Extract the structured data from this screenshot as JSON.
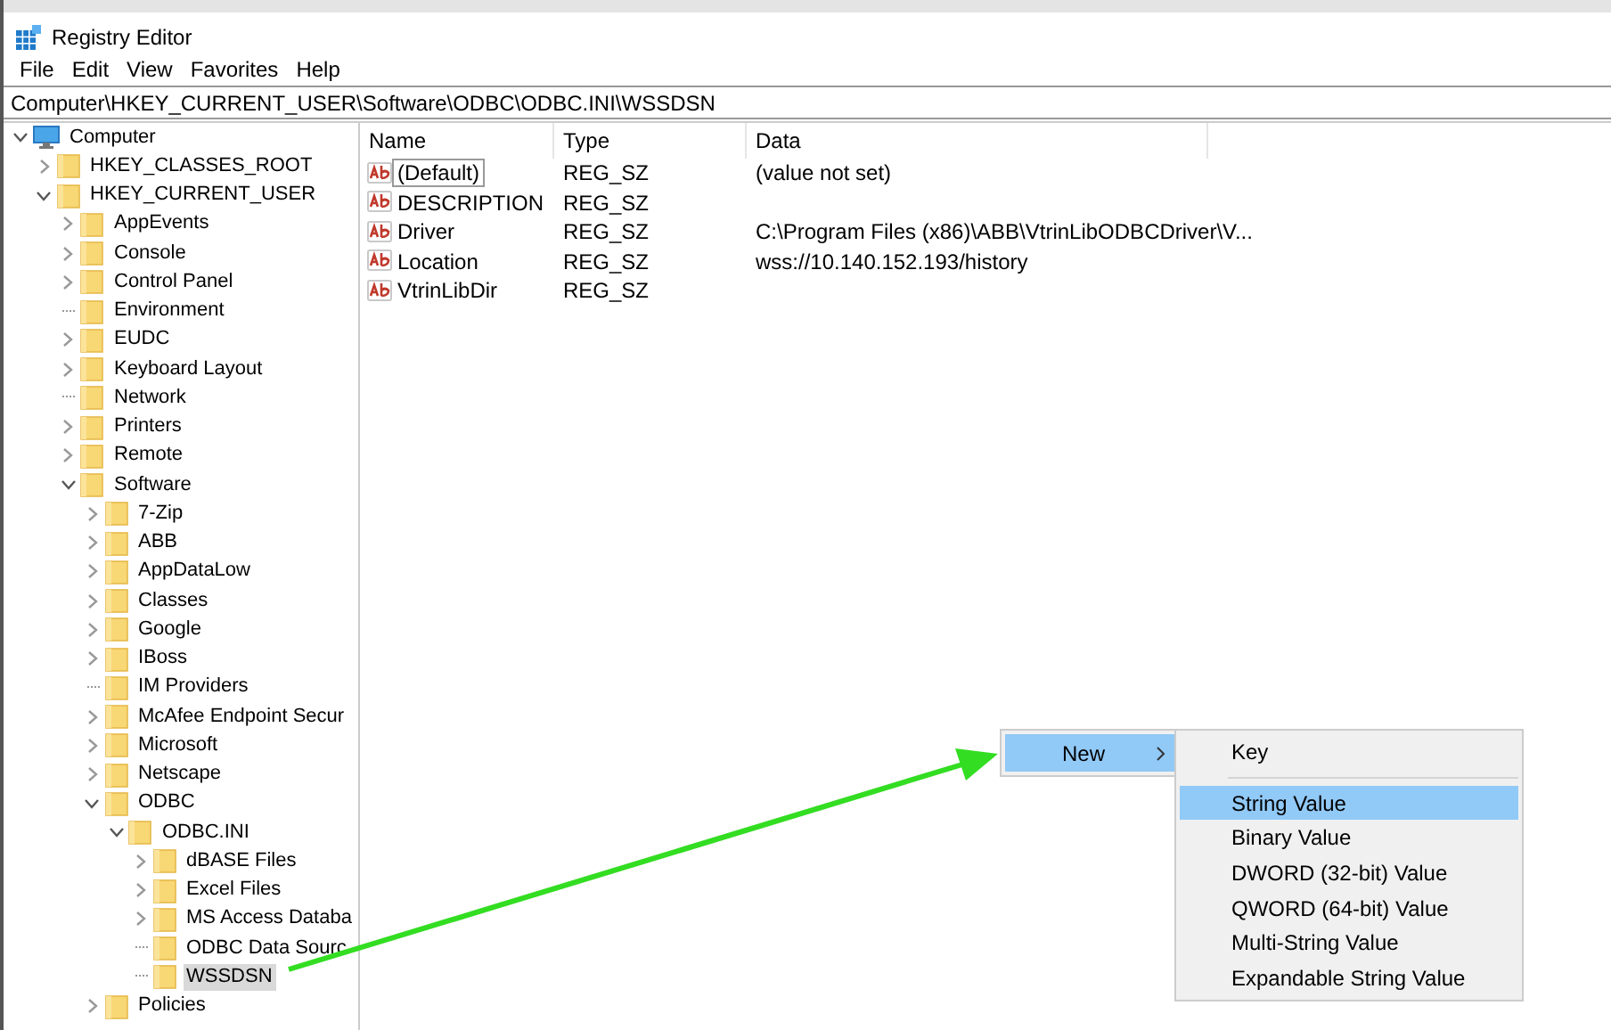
{
  "window": {
    "title": "Registry Editor"
  },
  "menu_bar": [
    "File",
    "Edit",
    "View",
    "Favorites",
    "Help"
  ],
  "address_bar": {
    "value": "Computer\\HKEY_CURRENT_USER\\Software\\ODBC\\ODBC.INI\\WSSDSN"
  },
  "tree": [
    {
      "label": "Computer",
      "kind": "computer",
      "expanded": true,
      "selected": false,
      "children": [
        {
          "label": "HKEY_CLASSES_ROOT",
          "kind": "folder",
          "expanded": false,
          "selected": false
        },
        {
          "label": "HKEY_CURRENT_USER",
          "kind": "folder",
          "expanded": true,
          "selected": false,
          "children": [
            {
              "label": "AppEvents",
              "kind": "folder",
              "expanded": false,
              "selected": false
            },
            {
              "label": "Console",
              "kind": "folder",
              "expanded": false,
              "selected": false
            },
            {
              "label": "Control Panel",
              "kind": "folder",
              "expanded": false,
              "selected": false
            },
            {
              "label": "Environment",
              "kind": "leaf-folder",
              "expanded": false,
              "selected": false
            },
            {
              "label": "EUDC",
              "kind": "folder",
              "expanded": false,
              "selected": false
            },
            {
              "label": "Keyboard Layout",
              "kind": "folder",
              "expanded": false,
              "selected": false
            },
            {
              "label": "Network",
              "kind": "leaf-folder",
              "expanded": false,
              "selected": false
            },
            {
              "label": "Printers",
              "kind": "folder",
              "expanded": false,
              "selected": false
            },
            {
              "label": "Remote",
              "kind": "folder",
              "expanded": false,
              "selected": false
            },
            {
              "label": "Software",
              "kind": "folder",
              "expanded": true,
              "selected": false,
              "children": [
                {
                  "label": "7-Zip",
                  "kind": "folder",
                  "expanded": false,
                  "selected": false
                },
                {
                  "label": "ABB",
                  "kind": "folder",
                  "expanded": false,
                  "selected": false
                },
                {
                  "label": "AppDataLow",
                  "kind": "folder",
                  "expanded": false,
                  "selected": false
                },
                {
                  "label": "Classes",
                  "kind": "folder",
                  "expanded": false,
                  "selected": false
                },
                {
                  "label": "Google",
                  "kind": "folder",
                  "expanded": false,
                  "selected": false
                },
                {
                  "label": "IBoss",
                  "kind": "folder",
                  "expanded": false,
                  "selected": false
                },
                {
                  "label": "IM Providers",
                  "kind": "leaf-folder",
                  "expanded": false,
                  "selected": false
                },
                {
                  "label": "McAfee Endpoint Secur",
                  "kind": "folder",
                  "expanded": false,
                  "selected": false
                },
                {
                  "label": "Microsoft",
                  "kind": "folder",
                  "expanded": false,
                  "selected": false
                },
                {
                  "label": "Netscape",
                  "kind": "folder",
                  "expanded": false,
                  "selected": false
                },
                {
                  "label": "ODBC",
                  "kind": "folder",
                  "expanded": true,
                  "selected": false,
                  "children": [
                    {
                      "label": "ODBC.INI",
                      "kind": "folder",
                      "expanded": true,
                      "selected": false,
                      "children": [
                        {
                          "label": "dBASE Files",
                          "kind": "folder",
                          "expanded": false,
                          "selected": false
                        },
                        {
                          "label": "Excel Files",
                          "kind": "folder",
                          "expanded": false,
                          "selected": false
                        },
                        {
                          "label": "MS Access Databa",
                          "kind": "folder",
                          "expanded": false,
                          "selected": false
                        },
                        {
                          "label": "ODBC Data Sourc",
                          "kind": "leaf-folder",
                          "expanded": false,
                          "selected": false
                        },
                        {
                          "label": "WSSDSN",
                          "kind": "leaf-folder",
                          "expanded": false,
                          "selected": true
                        }
                      ]
                    }
                  ]
                },
                {
                  "label": "Policies",
                  "kind": "folder",
                  "expanded": false,
                  "selected": false
                }
              ]
            }
          ]
        }
      ]
    }
  ],
  "values_table": {
    "columns": [
      "Name",
      "Type",
      "Data"
    ],
    "rows": [
      {
        "name": "(Default)",
        "type": "REG_SZ",
        "data": "(value not set)",
        "focused": true
      },
      {
        "name": "DESCRIPTION",
        "type": "REG_SZ",
        "data": "",
        "focused": false
      },
      {
        "name": "Driver",
        "type": "REG_SZ",
        "data": "C:\\Program Files (x86)\\ABB\\VtrinLibODBCDriver\\V...",
        "focused": false
      },
      {
        "name": "Location",
        "type": "REG_SZ",
        "data": "wss://10.140.152.193/history",
        "focused": false
      },
      {
        "name": "VtrinLibDir",
        "type": "REG_SZ",
        "data": "",
        "focused": false
      }
    ]
  },
  "context_menu": {
    "items": [
      {
        "label": "New",
        "has_submenu": true,
        "selected": true
      }
    ],
    "submenu": [
      {
        "kind": "item",
        "label": "Key",
        "selected": false
      },
      {
        "kind": "separator"
      },
      {
        "kind": "item",
        "label": "String Value",
        "selected": true
      },
      {
        "kind": "item",
        "label": "Binary Value",
        "selected": false
      },
      {
        "kind": "item",
        "label": "DWORD (32-bit) Value",
        "selected": false
      },
      {
        "kind": "item",
        "label": "QWORD (64-bit) Value",
        "selected": false
      },
      {
        "kind": "item",
        "label": "Multi-String Value",
        "selected": false
      },
      {
        "kind": "item",
        "label": "Expandable String Value",
        "selected": false
      }
    ]
  }
}
